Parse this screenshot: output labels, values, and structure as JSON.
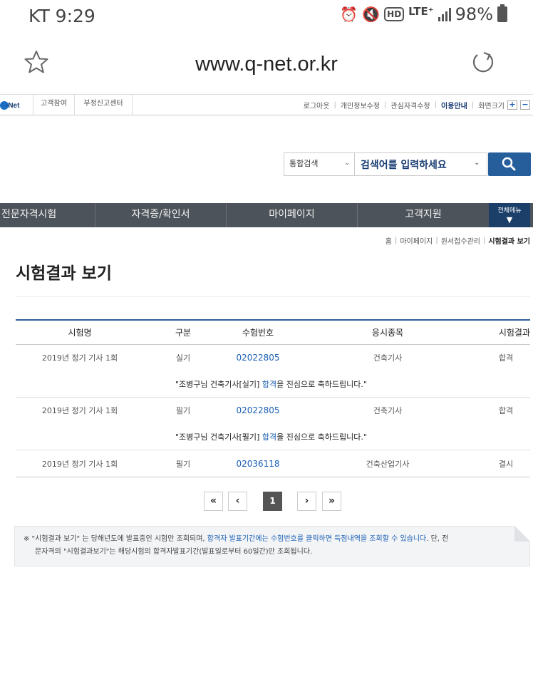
{
  "statusbar": {
    "carrier_time": "KT 9:29",
    "lte": "LTE⁺",
    "hd": "HD",
    "battery": "98%"
  },
  "browser": {
    "url": "www.q-net.or.kr"
  },
  "util": {
    "logo_text": "-Net",
    "tabs": [
      "고객참여",
      "부정신고센터"
    ],
    "links": [
      "로그아웃",
      "개인정보수정",
      "관심자격수정",
      "이용안내",
      "화면크기"
    ],
    "plus": "+",
    "minus": "−"
  },
  "search": {
    "scope": "통합검색",
    "placeholder": "검색어를 입력하세요"
  },
  "nav": {
    "items": [
      "전문자격시험",
      "자격증/확인서",
      "마이페이지",
      "고객지원"
    ],
    "all_menu": "전체메뉴"
  },
  "breadcrumb": [
    "홈",
    "마이페이지",
    "원서접수관리",
    "시험결과 보기"
  ],
  "page_title": "시험결과 보기",
  "table": {
    "headers": [
      "시험명",
      "구분",
      "수험번호",
      "응시종목",
      "시험결과"
    ],
    "rows": [
      {
        "exam": "2019년 정기 기사 1회",
        "type": "실기",
        "number": "02022805",
        "subject": "건축기사",
        "result": "합격",
        "msg_prefix": "\"조병구님 건축기사[실기] ",
        "msg_pass": "합격",
        "msg_suffix": "을 진심으로 축하드립니다.\""
      },
      {
        "exam": "2019년 정기 기사 1회",
        "type": "필기",
        "number": "02022805",
        "subject": "건축기사",
        "result": "합격",
        "msg_prefix": "\"조병구님 건축기사[필기] ",
        "msg_pass": "합격",
        "msg_suffix": "을 진심으로 축하드립니다.\""
      },
      {
        "exam": "2019년 정기 기사 1회",
        "type": "필기",
        "number": "02036118",
        "subject": "건축산업기사",
        "result": "결시"
      }
    ]
  },
  "pager": {
    "first": "«",
    "prev": "‹",
    "current": "1",
    "next": "›",
    "last": "»"
  },
  "notice": {
    "part1": "※ \"시험결과 보기\" 는 당해년도에 발표중인 시험만 조회되며, ",
    "highlight": "합격자 발표기간에는 수험번호를 클릭하면 득점내역을 조회할 수 있습니다",
    "part2": ". 단, 전",
    "line2": "문자격의 \"시험결과보기\"는 해당시험의 합격자발표기간(발표일로부터 60일간)만 조회됩니다."
  },
  "colors": {
    "nav_bg": "#4d535a",
    "nav_all_bg": "#1c3f69",
    "accent_blue": "#1a5fb4",
    "search_btn": "#265e9c",
    "table_top_border": "#2d5f99"
  }
}
